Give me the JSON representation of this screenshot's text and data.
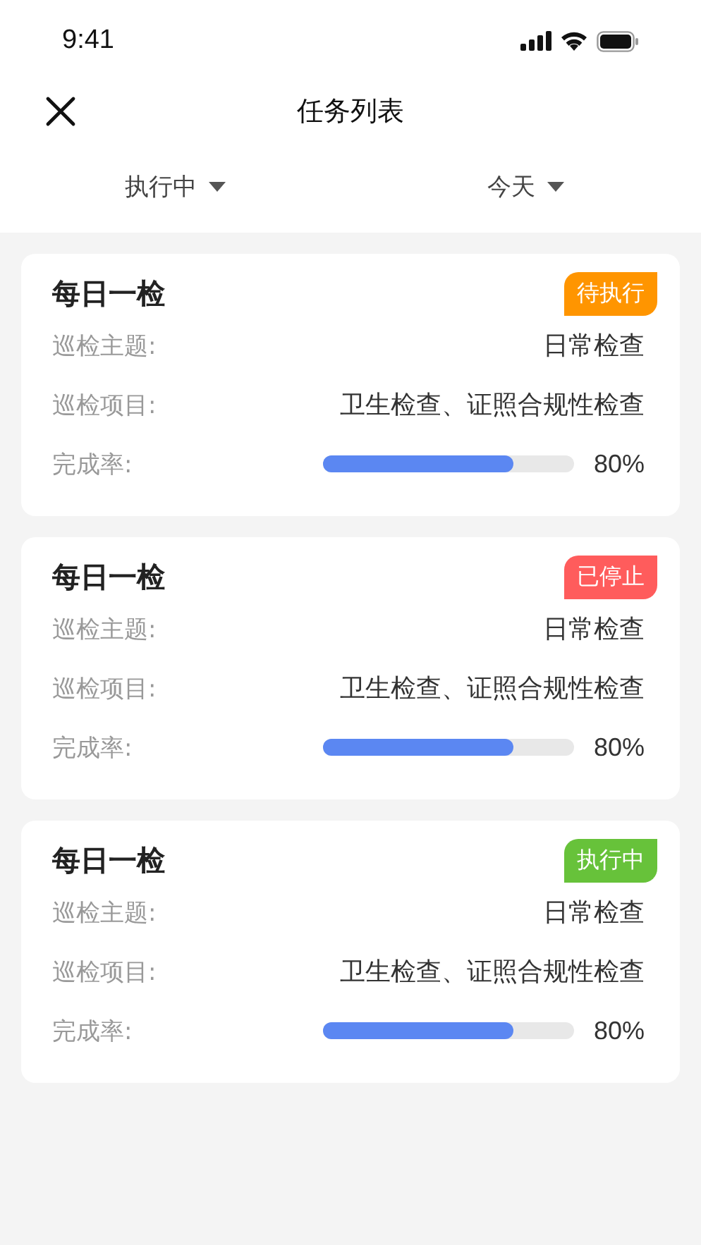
{
  "status_bar": {
    "time": "9:41"
  },
  "nav": {
    "title": "任务列表"
  },
  "filters": [
    {
      "label": "执行中"
    },
    {
      "label": "今天"
    }
  ],
  "tasks": [
    {
      "title": "每日一检",
      "status": "待执行",
      "color": "#ff9500",
      "fields": [
        {
          "kind": "text",
          "label": "巡检主题:",
          "value": "日常检查"
        },
        {
          "kind": "text",
          "label": "巡检项目:",
          "value": "卫生检查、证照合规性检查"
        },
        {
          "kind": "progress",
          "label": "完成率:",
          "level": 0.76,
          "reading": "80%"
        }
      ]
    },
    {
      "title": "每日一检",
      "status": "已停止",
      "color": "#ff5c5c",
      "fields": [
        {
          "kind": "text",
          "label": "巡检主题:",
          "value": "日常检查"
        },
        {
          "kind": "text",
          "label": "巡检项目:",
          "value": "卫生检查、证照合规性检查"
        },
        {
          "kind": "progress",
          "label": "完成率:",
          "level": 0.76,
          "reading": "80%"
        }
      ]
    },
    {
      "title": "每日一检",
      "status": "执行中",
      "color": "#67c23a",
      "fields": [
        {
          "kind": "text",
          "label": "巡检主题:",
          "value": "日常检查"
        },
        {
          "kind": "text",
          "label": "巡检项目:",
          "value": "卫生检查、证照合规性检查"
        },
        {
          "kind": "progress",
          "label": "完成率:",
          "level": 0.76,
          "reading": "80%"
        }
      ]
    }
  ]
}
